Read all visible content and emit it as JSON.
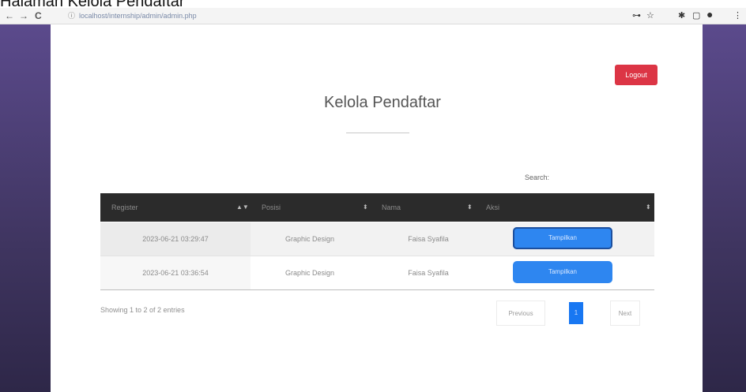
{
  "caption": "Halaman Kelola Pendaftar",
  "browser": {
    "back_glyph": "←",
    "forward_glyph": "→",
    "reload_glyph": "C",
    "url": "localhost/internship/admin/admin.php",
    "info_glyph": "ⓘ",
    "extensions": [
      "⊶",
      "☆",
      "✱",
      "▢",
      "●",
      "⋮"
    ]
  },
  "page": {
    "logout_label": "Logout",
    "title": "Kelola Pendaftar",
    "search_label": "Search:",
    "search_value": ""
  },
  "table": {
    "columns": [
      {
        "label": "Register",
        "sort_glyph": "▲▼"
      },
      {
        "label": "Posisi",
        "sort_glyph": "⬍"
      },
      {
        "label": "Nama",
        "sort_glyph": "⬍"
      },
      {
        "label": "Aksi",
        "sort_glyph": "⬍"
      }
    ],
    "rows": [
      {
        "register": "2023-06-21 03:29:47",
        "posisi": "Graphic Design",
        "nama": "Faisa Syafila",
        "action_label": "Tampilkan"
      },
      {
        "register": "2023-06-21 03:36:54",
        "posisi": "Graphic Design",
        "nama": "Faisa Syafila",
        "action_label": "Tampilkan"
      }
    ]
  },
  "footer": {
    "info": "Showing 1 to 2 of 2 entries",
    "prev_label": "Previous",
    "current_page": "1",
    "next_label": "Next"
  },
  "colors": {
    "accent": "#2e86f0",
    "logout": "#dc3545",
    "table_header": "#2b2b2b",
    "side_panel": "#4a3f72"
  }
}
